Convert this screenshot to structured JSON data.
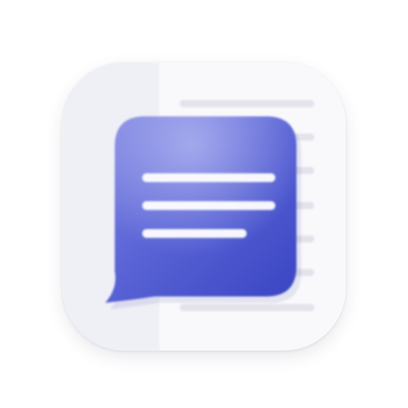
{
  "icon": {
    "name": "chat-notes-app-icon",
    "glyph": "speech-bubble-with-text-lines",
    "colors": {
      "tile_left": "#efeff6",
      "tile_right": "#f9f9fb",
      "doc_lines": "#e4e4ec",
      "bubble_top": "#8e93e6",
      "bubble_main": "#5561d4",
      "bubble_bottom": "#3a45c4",
      "bubble_lines": "#ffffff"
    }
  }
}
